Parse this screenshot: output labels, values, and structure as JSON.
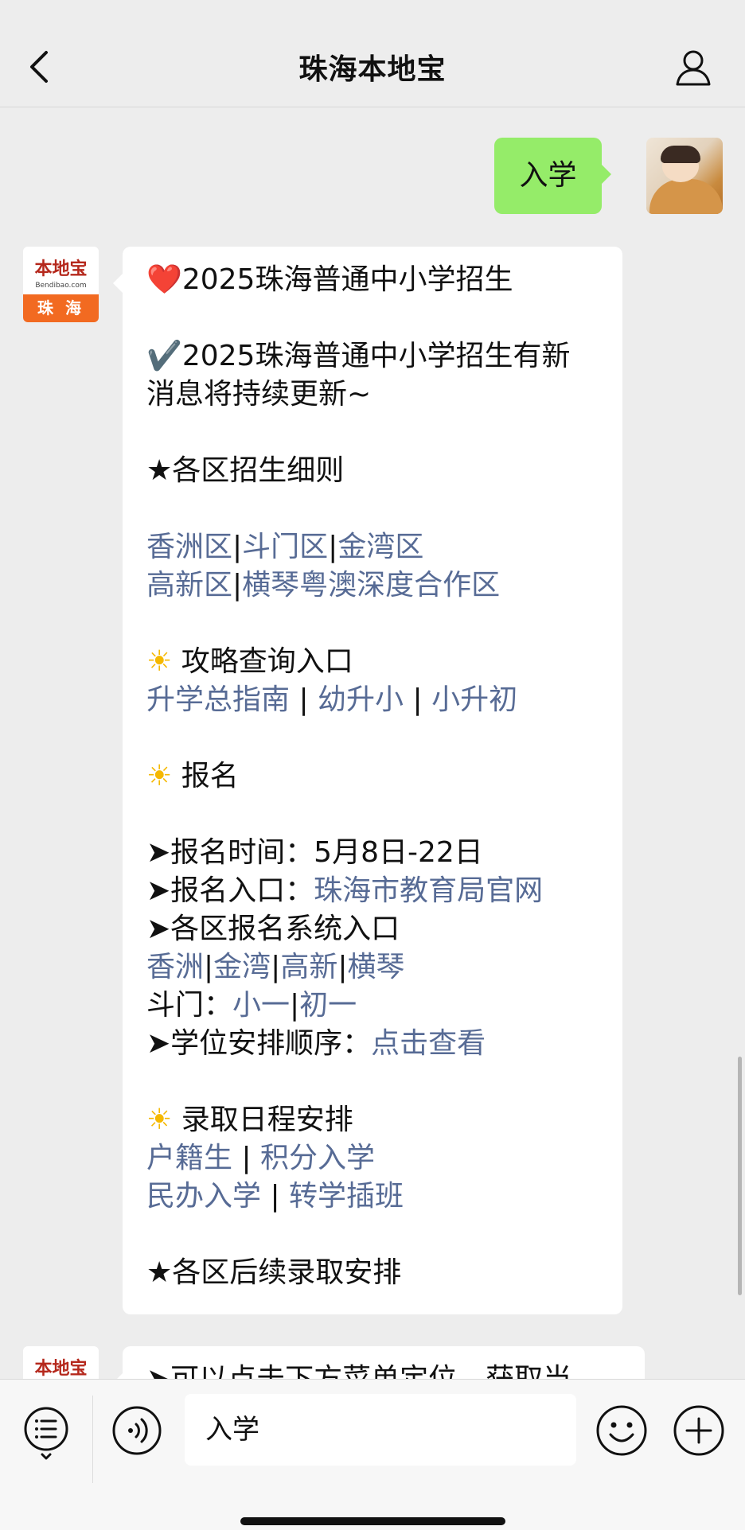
{
  "header": {
    "title": "珠海本地宝",
    "back_icon": "chevron-left-icon",
    "profile_icon": "person-icon"
  },
  "user_message": {
    "text": "入学"
  },
  "bot": {
    "avatar": {
      "logo_text": "本地宝",
      "site_text": "Bendibao.com",
      "city": "珠 海"
    }
  },
  "message": {
    "title_icon": "❤️",
    "title": "2025珠海普通中小学招生",
    "check_icon": "✔️",
    "update_line1": "2025珠海普通中小学招生有新",
    "update_line2": "消息将持续更新~",
    "districts_heading": "★各区招生细则",
    "districts": [
      "香洲区",
      "斗门区",
      "金湾区",
      "高新区",
      "横琴粤澳深度合作区"
    ],
    "sun_icon": "☀",
    "guide_heading": "攻略查询入口",
    "guide_links": [
      "升学总指南",
      "幼升小",
      "小升初"
    ],
    "signup_heading": "报名",
    "signup_time_label": "➤报名时间：",
    "signup_time_value": "5月8日-22日",
    "signup_entry_label": "➤报名入口：",
    "signup_entry_link": "珠海市教育局官网",
    "district_system_label": "➤各区报名系统入口",
    "district_system_links": [
      "香洲",
      "金湾",
      "高新",
      "横琴"
    ],
    "doumen_label": "斗门：",
    "doumen_links": [
      "小一",
      "初一"
    ],
    "order_label": "➤学位安排顺序：",
    "order_link": "点击查看",
    "admission_heading": "录取日程安排",
    "admission_links": [
      "户籍生",
      "积分入学",
      "民办入学",
      "转学插班"
    ],
    "followup_heading": "★各区后续录取安排",
    "next_message_partial": "➤可以点击下方菜单定位，获取当"
  },
  "input": {
    "text": "入学"
  },
  "bottom_bar": {
    "menu_icon": "list-menu-icon",
    "voice_icon": "voice-icon",
    "emoji_icon": "emoji-icon",
    "plus_icon": "plus-icon"
  }
}
